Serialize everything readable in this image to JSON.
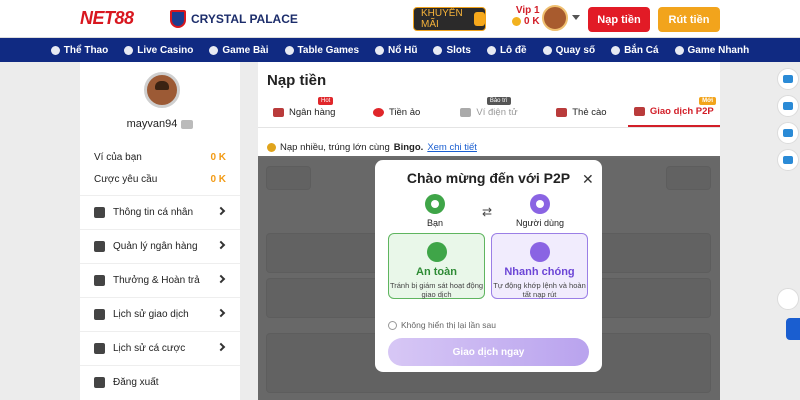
{
  "header": {
    "logo": "NET88",
    "partner": "CRYSTAL PALACE",
    "promo_label": "KHUYẾN MÃI",
    "vip_label": "Vip 1",
    "balance": "0 K",
    "deposit_label": "Nạp tiền",
    "withdraw_label": "Rút tiền"
  },
  "nav": {
    "items": [
      {
        "label": "Thể Thao"
      },
      {
        "label": "Live Casino"
      },
      {
        "label": "Game Bài"
      },
      {
        "label": "Table Games"
      },
      {
        "label": "Nổ Hũ"
      },
      {
        "label": "Slots"
      },
      {
        "label": "Lô đề"
      },
      {
        "label": "Quay số"
      },
      {
        "label": "Bắn Cá"
      },
      {
        "label": "Game Nhanh"
      }
    ]
  },
  "sidebar": {
    "username": "mayvan94",
    "wallet_label": "Ví của bạn",
    "wallet_value": "0 K",
    "bet_req_label": "Cược yêu cầu",
    "bet_req_value": "0 K",
    "menu": [
      {
        "label": "Thông tin cá nhân",
        "icon": "user-icon"
      },
      {
        "label": "Quản lý ngân hàng",
        "icon": "bank-icon"
      },
      {
        "label": "Thưởng & Hoàn trả",
        "icon": "gift-icon"
      },
      {
        "label": "Lịch sử giao dịch",
        "icon": "history-icon"
      },
      {
        "label": "Lịch sử cá cược",
        "icon": "bet-history-icon"
      },
      {
        "label": "Đăng xuất",
        "icon": "logout-icon"
      }
    ]
  },
  "main": {
    "title": "Nạp tiền",
    "tabs": [
      {
        "label": "Ngân hàng",
        "badge": "Hot"
      },
      {
        "label": "Tiền ảo",
        "badge": ""
      },
      {
        "label": "Ví điện tử",
        "badge": "Bảo trì"
      },
      {
        "label": "Thẻ cào",
        "badge": ""
      },
      {
        "label": "Giao dịch P2P",
        "badge": "Mới"
      }
    ],
    "banner_text": "Nạp nhiều, trúng lớn cùng",
    "banner_brand": "Bingo.",
    "banner_link": "Xem chi tiết"
  },
  "modal": {
    "title": "Chào mừng đến với P2P",
    "party_left": "Bạn",
    "party_right": "Người dùng",
    "card_left_title": "An toàn",
    "card_left_desc": "Tránh bị giám sát hoạt động giao dịch",
    "card_right_title": "Nhanh chóng",
    "card_right_desc": "Tự động khớp lệnh và hoàn tất nạp rút",
    "checkbox_label": "Không hiển thị lại lần sau",
    "cta_label": "Giao dịch ngay"
  },
  "colors": {
    "brand_red": "#d21e28",
    "nav_blue": "#102a82",
    "accent_orange": "#f2a41c",
    "green": "#3fa548",
    "purple": "#8a64e3"
  }
}
